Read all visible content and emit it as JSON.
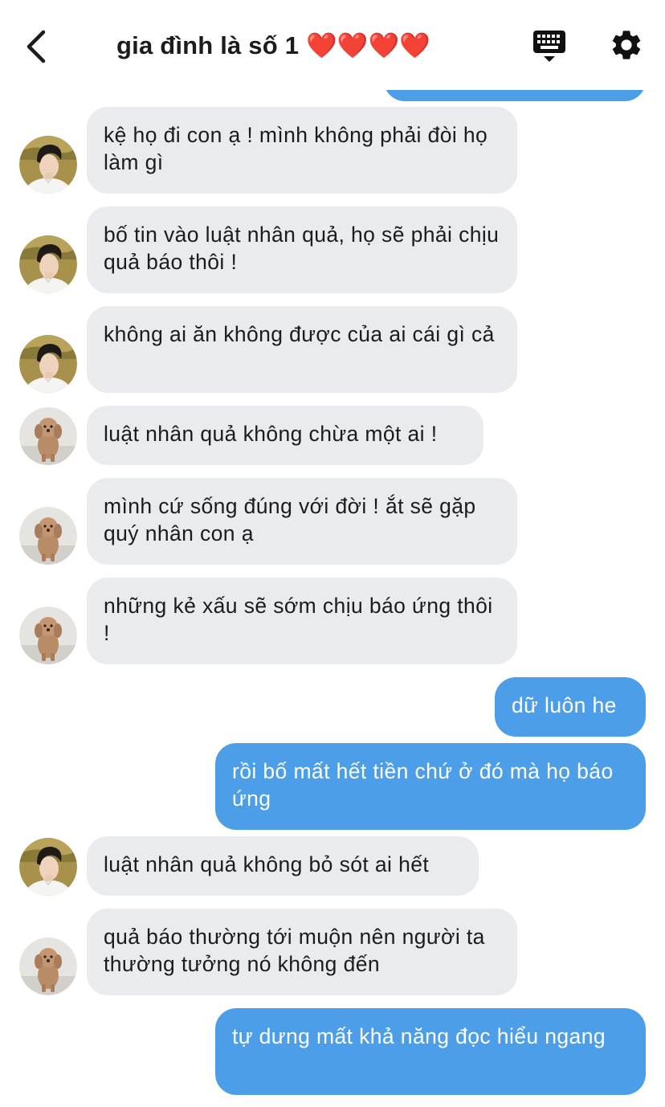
{
  "header": {
    "back_icon": "chevron-left-icon",
    "title": "gia đình là số 1 ❤️❤️❤️❤️",
    "keyboard_icon": "keyboard-icon",
    "settings_icon": "gear-icon"
  },
  "colors": {
    "incoming_bubble": "#e9ebef",
    "outgoing_bubble": "#4d9ee8",
    "text": "#1c1c1e"
  },
  "messages": [
    {
      "sender": "son",
      "text": "kệ họ đi con ạ ! mình không phải đòi họ làm gì"
    },
    {
      "sender": "son",
      "text": "bố tin vào luật nhân quả, họ sẽ phải chịu quả báo thôi !"
    },
    {
      "sender": "son",
      "text": "không ai ăn không được của ai cái gì cả"
    },
    {
      "sender": "dog",
      "text": "luật nhân quả không chừa một ai !"
    },
    {
      "sender": "dog",
      "text": "mình cứ sống đúng với đời ! ắt sẽ gặp quý nhân con ạ"
    },
    {
      "sender": "dog",
      "text": "những kẻ xấu sẽ sớm chịu báo ứng thôi !"
    },
    {
      "sender": "me",
      "text": "dữ luôn he"
    },
    {
      "sender": "me",
      "text": "rồi bố mất hết tiền chứ ở đó mà họ báo ứng"
    },
    {
      "sender": "son",
      "text": "luật nhân quả không bỏ sót ai hết"
    },
    {
      "sender": "dog",
      "text": "quả báo thường tới muộn nên người ta thường tưởng nó không đến"
    },
    {
      "sender": "me",
      "text": "tự dưng mất khả năng đọc hiểu ngang"
    }
  ]
}
